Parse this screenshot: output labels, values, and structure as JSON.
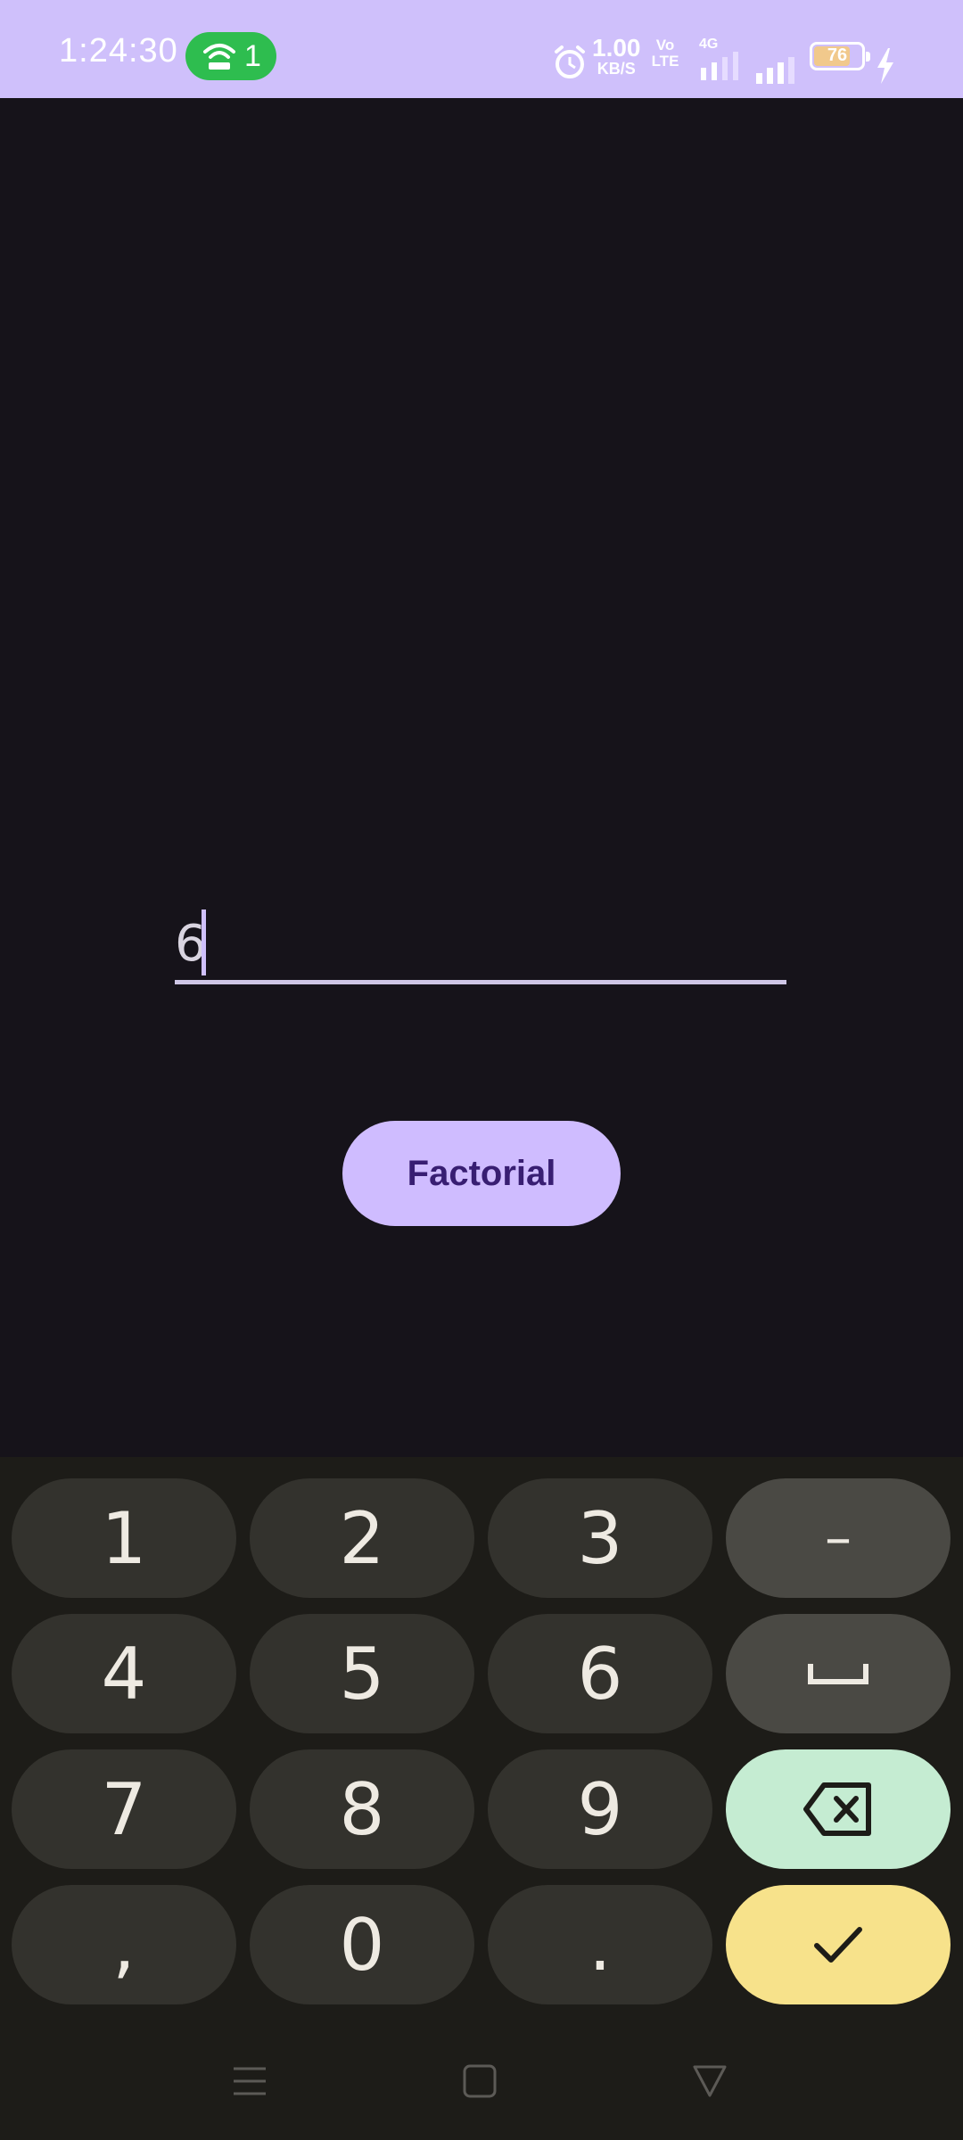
{
  "status_bar": {
    "time": "1:24:30",
    "hotspot_count": "1",
    "net_speed_value": "1.00",
    "net_speed_unit": "KB/S",
    "volte_line1": "Vo LTE",
    "network_type": "4G",
    "battery_level": "76",
    "background_color": "#cfc0fb"
  },
  "input": {
    "value": "6"
  },
  "action_button": {
    "label": "Factorial",
    "color": "#cfbcff"
  },
  "keyboard": {
    "keys": [
      [
        "1",
        "2",
        "3",
        "–"
      ],
      [
        "4",
        "5",
        "6",
        "space"
      ],
      [
        "7",
        "8",
        "9",
        "backspace"
      ],
      [
        ",",
        "0",
        ".",
        "done"
      ]
    ],
    "digits": {
      "k1": "1",
      "k2": "2",
      "k3": "3",
      "minus": "–",
      "k4": "4",
      "k5": "5",
      "k6": "6",
      "k7": "7",
      "k8": "8",
      "k9": "9",
      "comma": ",",
      "k0": "0",
      "dot": "."
    },
    "delete_color": "#c5ecd2",
    "done_color": "#f7e28b"
  },
  "icons": {
    "status": [
      "hotspot-icon",
      "alarm-icon",
      "signal-icon",
      "battery-icon",
      "charging-icon"
    ],
    "keyboard": [
      "space-icon",
      "backspace-icon",
      "checkmark-icon"
    ],
    "navigation": [
      "menu-icon",
      "home-icon",
      "back-icon"
    ]
  }
}
